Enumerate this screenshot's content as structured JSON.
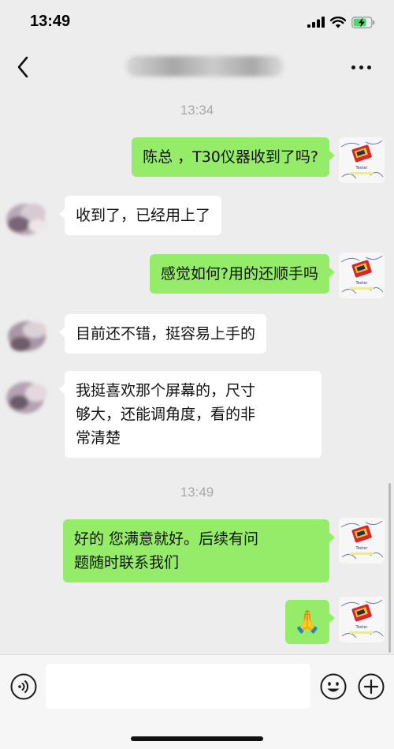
{
  "status_bar": {
    "time": "13:49",
    "icons": [
      "signal-icon",
      "wifi-icon",
      "battery-charging-icon"
    ]
  },
  "nav": {
    "back_icon": "chevron-left-icon",
    "title": "",
    "more_icon": "more-dots-icon"
  },
  "messages": [
    {
      "type": "timestamp",
      "text": "13:34"
    },
    {
      "type": "message",
      "side": "right",
      "text": "陈总 ，T30仪器收到了吗?"
    },
    {
      "type": "message",
      "side": "left",
      "text": "收到了，已经用上了"
    },
    {
      "type": "message",
      "side": "right",
      "text": "感觉如何?用的还顺手吗"
    },
    {
      "type": "message",
      "side": "left",
      "text": "目前还不错，挺容易上手的"
    },
    {
      "type": "message",
      "side": "left",
      "lines": [
        "我挺喜欢那个屏幕的，尺寸",
        "够大，还能调角度，看的非",
        "常清楚"
      ]
    },
    {
      "type": "timestamp",
      "text": "13:49"
    },
    {
      "type": "message",
      "side": "right",
      "lines": [
        "好的  您满意就好。后续有问",
        "题随时联系我们"
      ]
    },
    {
      "type": "message",
      "side": "right",
      "emoji": "🙏"
    }
  ],
  "input_bar": {
    "placeholder": "",
    "icons": [
      "voice-icon",
      "emoji-icon",
      "plus-icon"
    ]
  },
  "colors": {
    "background": "#ededed",
    "bubble_self": "#95ec69",
    "bubble_other": "#ffffff",
    "timestamp": "#a8a8a8"
  }
}
